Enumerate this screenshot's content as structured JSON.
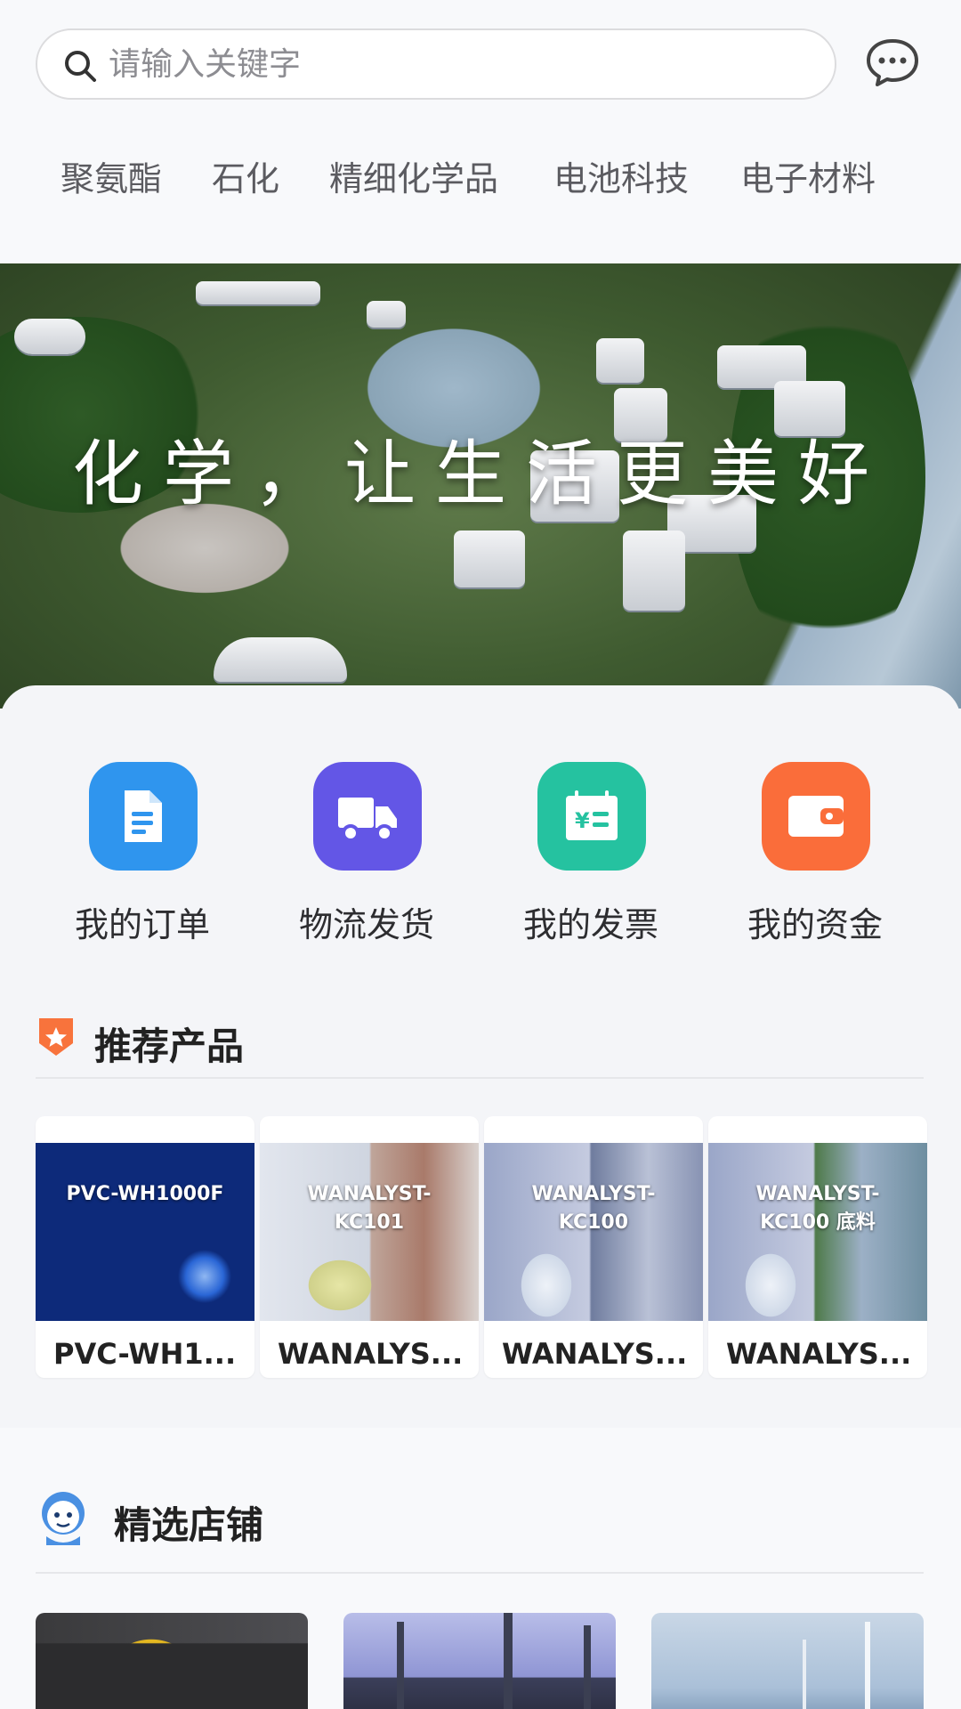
{
  "search": {
    "placeholder": "请输入关键字"
  },
  "header": {
    "message_icon": "chat-bubble-icon"
  },
  "categories": [
    "聚氨酯",
    "石化",
    "精细化学品",
    "电池科技",
    "电子材料"
  ],
  "banner": {
    "title": "化学，让生活更美好"
  },
  "quick_actions": [
    {
      "label": "我的订单",
      "icon": "document-icon",
      "color": "#2f95ee"
    },
    {
      "label": "物流发货",
      "icon": "truck-icon",
      "color": "#6356e6"
    },
    {
      "label": "我的发票",
      "icon": "invoice-icon",
      "color": "#25c2a0"
    },
    {
      "label": "我的资金",
      "icon": "wallet-icon",
      "color": "#fa6d3a"
    }
  ],
  "recommended": {
    "title": "推荐产品",
    "products": [
      {
        "image_label": "PVC-WH1000F",
        "name": "PVC-WH1..."
      },
      {
        "image_label": "WANALYST-KC101",
        "name": "WANALYS..."
      },
      {
        "image_label": "WANALYST-KC100",
        "name": "WANALYS..."
      },
      {
        "image_label": "WANALYST-KC100 底料",
        "name": "WANALYS..."
      }
    ]
  },
  "stores": {
    "title": "精选店铺"
  }
}
